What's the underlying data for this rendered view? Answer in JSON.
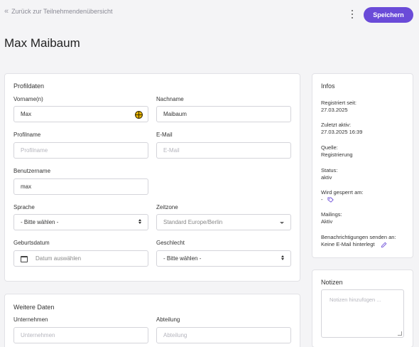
{
  "nav": {
    "back_label": "Zurück zur Teilnehmendenübersicht",
    "save_label": "Speichern"
  },
  "page": {
    "title": "Max Maibaum"
  },
  "profile": {
    "title": "Profildaten",
    "firstname": {
      "label": "Vorname(n)",
      "value": "Max"
    },
    "lastname": {
      "label": "Nachname",
      "value": "Maibaum"
    },
    "profilename": {
      "label": "Profilname",
      "placeholder": "Profilname"
    },
    "email": {
      "label": "E-Mail",
      "placeholder": "E-Mail"
    },
    "username": {
      "label": "Benutzername",
      "value": "max"
    },
    "language": {
      "label": "Sprache",
      "value": "- Bitte wählen -"
    },
    "timezone": {
      "label": "Zeitzone",
      "value": "Standard Europe/Berlin"
    },
    "birthdate": {
      "label": "Geburtsdatum",
      "placeholder": "Datum auswählen"
    },
    "gender": {
      "label": "Geschlecht",
      "value": "- Bitte wählen -"
    }
  },
  "more": {
    "title": "Weitere Daten",
    "company": {
      "label": "Unternehmen",
      "placeholder": "Unternehmen"
    },
    "department": {
      "label": "Abteilung",
      "placeholder": "Abteilung"
    }
  },
  "infos": {
    "title": "Infos",
    "registered": {
      "label": "Registriert seit:",
      "value": "27.03.2025"
    },
    "last_active": {
      "label": "Zuletzt aktiv:",
      "value": "27.03.2025 16:39"
    },
    "source": {
      "label": "Quelle:",
      "value": "Registrierung"
    },
    "status": {
      "label": "Status:",
      "value": "aktiv"
    },
    "locked": {
      "label": "Wird gesperrt am:",
      "value": "-"
    },
    "mailings": {
      "label": "Mailings:",
      "value": "Aktiv"
    },
    "notifications": {
      "label": "Benachrichtigungen senden an:",
      "value": "Keine E-Mail hinterlegt"
    }
  },
  "notes": {
    "title": "Notizen",
    "placeholder": "Notizen hinzufügen ..."
  },
  "colors": {
    "accent": "#6a4bd8",
    "background": "#f4f4f6"
  },
  "icons": [
    "double-chevron-left-icon",
    "kebab-menu-icon",
    "football-icon",
    "calendar-icon",
    "tag-icon",
    "pencil-icon"
  ]
}
